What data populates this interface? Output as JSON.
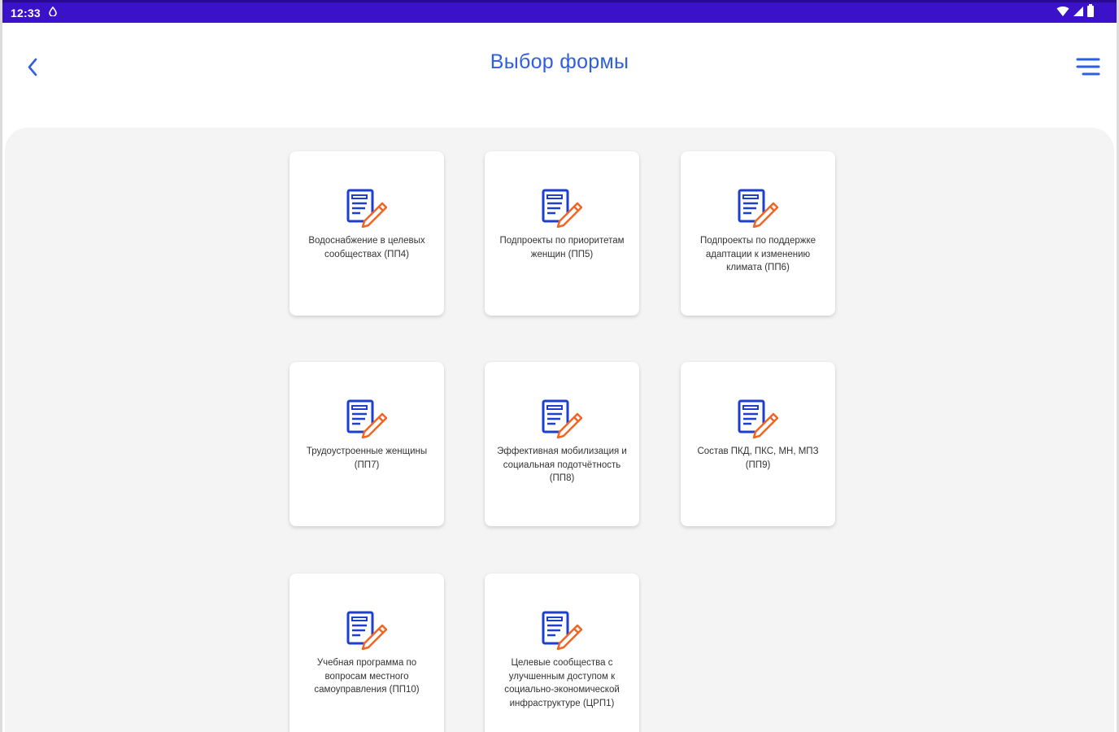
{
  "status_bar": {
    "time": "12:33",
    "left_icon": "data-saver-icon",
    "right_icons": [
      "wifi-icon",
      "signal-icon",
      "battery-icon"
    ]
  },
  "header": {
    "title": "Выбор формы",
    "back_icon": "chevron-left-icon",
    "menu_icon": "menu-icon"
  },
  "colors": {
    "status_bar": "#3b12c9",
    "accent": "#2f5fe0",
    "icon_blue": "#1c3fcf",
    "icon_orange": "#f26522",
    "content_bg": "#f4f4f4"
  },
  "forms": [
    {
      "label": "Водоснабжение в целевых сообществах (ПП4)",
      "icon": "form-edit-icon"
    },
    {
      "label": "Подпроекты по приоритетам женщин (ПП5)",
      "icon": "form-edit-icon"
    },
    {
      "label": "Подпроекты по поддержке адаптации к изменению климата (ПП6)",
      "icon": "form-edit-icon"
    },
    {
      "label": "Трудоустроенные женщины (ПП7)",
      "icon": "form-edit-icon"
    },
    {
      "label": "Эффективная мобилизация и социальная подотчётность (ПП8)",
      "icon": "form-edit-icon"
    },
    {
      "label": "Состав ПКД, ПКС, МН, МПЗ (ПП9)",
      "icon": "form-edit-icon"
    },
    {
      "label": "Учебная программа по вопросам местного самоуправления (ПП10)",
      "icon": "form-edit-icon"
    },
    {
      "label": "Целевые сообщества с улучшенным доступом к социально-экономической инфраструктуре (ЦРП1)",
      "icon": "form-edit-icon"
    }
  ]
}
